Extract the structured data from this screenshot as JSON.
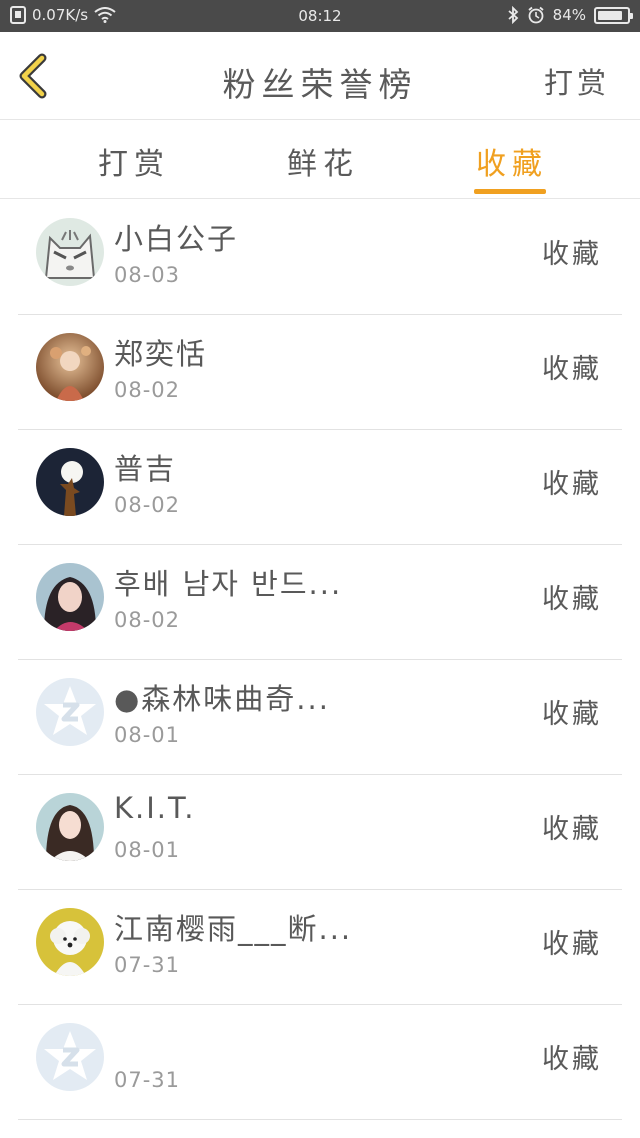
{
  "status_bar": {
    "speed": "0.07K/s",
    "time": "08:12",
    "battery": "84%",
    "battery_level": 0.84,
    "icons": [
      "storage-icon",
      "wifi-icon",
      "bluetooth-icon",
      "alarm-icon",
      "battery-icon"
    ]
  },
  "header": {
    "back_icon": "chevron-left-icon",
    "title": "粉丝荣誉榜",
    "action_label": "打赏",
    "accent_color": "#f0a020"
  },
  "tabs": [
    {
      "label": "打赏",
      "active": false
    },
    {
      "label": "鲜花",
      "active": false
    },
    {
      "label": "收藏",
      "active": true
    }
  ],
  "list": [
    {
      "name": "小白公子",
      "date": "08-03",
      "action": "收藏",
      "avatar": "cat-cartoon"
    },
    {
      "name": "郑奕恬",
      "date": "08-02",
      "action": "收藏",
      "avatar": "girl-photo"
    },
    {
      "name": "普吉",
      "date": "08-02",
      "action": "收藏",
      "avatar": "night-moon"
    },
    {
      "name": "후배 남자 반드...",
      "date": "08-02",
      "action": "收藏",
      "avatar": "girl-portrait"
    },
    {
      "name": "●森林味曲奇...",
      "date": "08-01",
      "action": "收藏",
      "avatar": "default-qq"
    },
    {
      "name": "K.I.T.",
      "date": "08-01",
      "action": "收藏",
      "avatar": "woman-portrait"
    },
    {
      "name": "江南樱雨___断...",
      "date": "07-31",
      "action": "收藏",
      "avatar": "white-dog"
    },
    {
      "name": "",
      "date": "07-31",
      "action": "收藏",
      "avatar": "default-qq"
    }
  ]
}
